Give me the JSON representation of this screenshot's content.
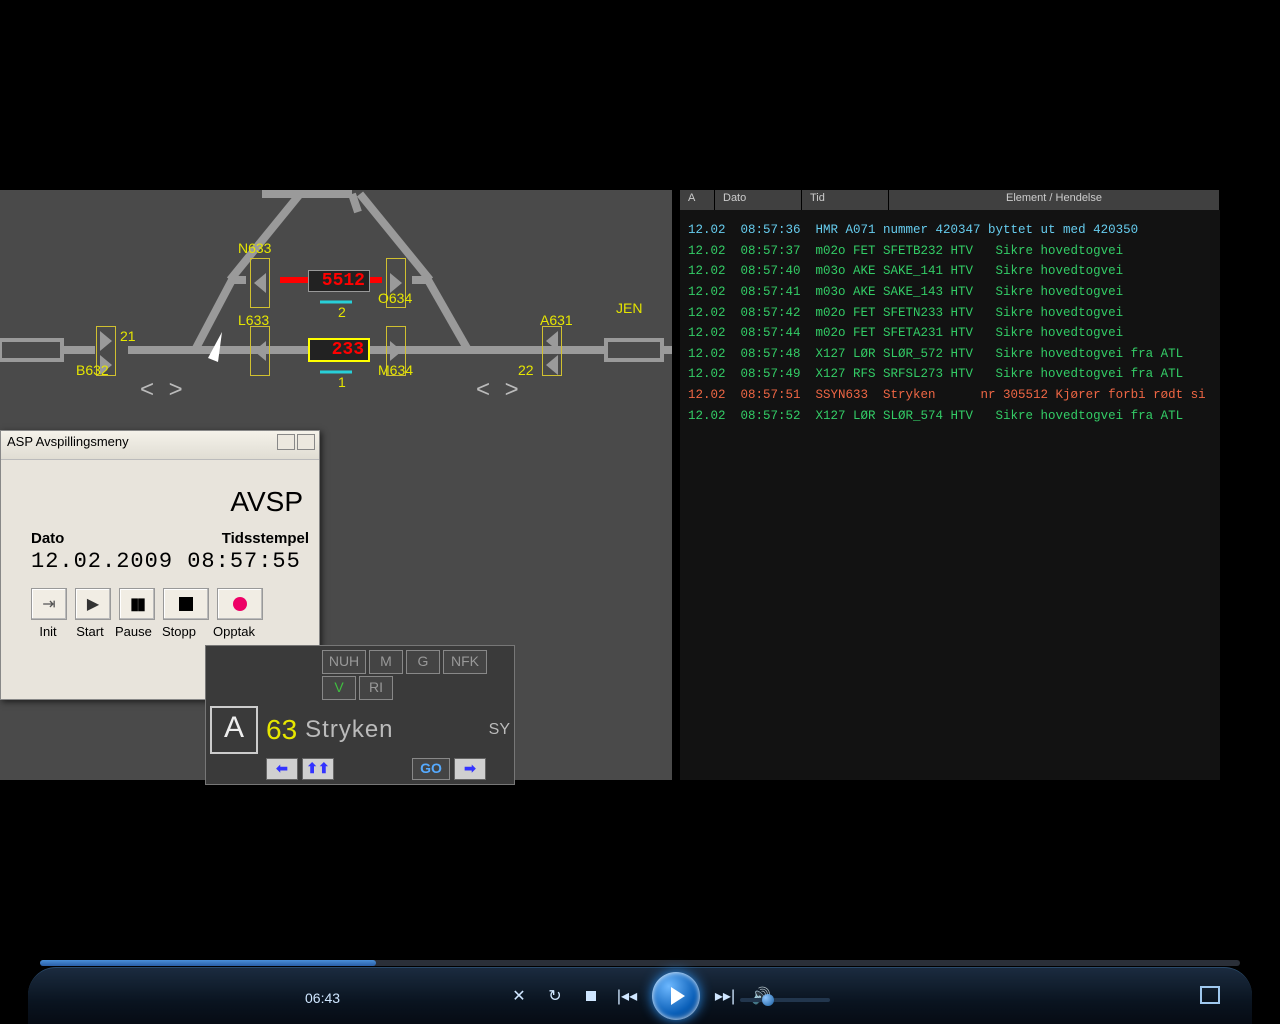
{
  "log": {
    "headers": {
      "a": "A",
      "dato": "Dato",
      "tid": "Tid",
      "ev": "Element / Hendelse"
    },
    "rows": [
      {
        "c": "cyan",
        "d": "12.02",
        "t": "08:57:36",
        "txt": "HMR A071 nummer 420347 byttet ut med 420350"
      },
      {
        "c": "green",
        "d": "12.02",
        "t": "08:57:37",
        "txt": "m02o FET SFETB232 HTV   Sikre hovedtogvei"
      },
      {
        "c": "green",
        "d": "12.02",
        "t": "08:57:40",
        "txt": "m03o AKE SAKE_141 HTV   Sikre hovedtogvei"
      },
      {
        "c": "green",
        "d": "12.02",
        "t": "08:57:41",
        "txt": "m03o AKE SAKE_143 HTV   Sikre hovedtogvei"
      },
      {
        "c": "green",
        "d": "12.02",
        "t": "08:57:42",
        "txt": "m02o FET SFETN233 HTV   Sikre hovedtogvei"
      },
      {
        "c": "green",
        "d": "12.02",
        "t": "08:57:44",
        "txt": "m02o FET SFETA231 HTV   Sikre hovedtogvei"
      },
      {
        "c": "green",
        "d": "12.02",
        "t": "08:57:48",
        "txt": "X127 LØR SLØR_572 HTV   Sikre hovedtogvei fra ATL"
      },
      {
        "c": "green",
        "d": "12.02",
        "t": "08:57:49",
        "txt": "X127 RFS SRFSL273 HTV   Sikre hovedtogvei fra ATL"
      },
      {
        "c": "red",
        "d": "12.02",
        "t": "08:57:51",
        "txt": "SSYN633  Stryken      nr 305512 Kjører forbi rødt si"
      },
      {
        "c": "green",
        "d": "12.02",
        "t": "08:57:52",
        "txt": "X127 LØR SLØR_574 HTV   Sikre hovedtogvei fra ATL"
      }
    ]
  },
  "diagram": {
    "jen": "JEN",
    "n633": "N633",
    "o634": "O634",
    "l633": "L633",
    "m634": "M634",
    "b632": "B632",
    "a631": "A631",
    "num21": "21",
    "num22": "22",
    "track1": "1",
    "track2": "2",
    "train_5512": "5512",
    "train_233": "233"
  },
  "avsp": {
    "title": "ASP Avspillingsmeny",
    "header": "AVSP",
    "lbl_dato": "Dato",
    "lbl_ts": "Tidsstempel",
    "value": "12.02.2009 08:57:55",
    "btn_init": "Init",
    "btn_start": "Start",
    "btn_pause": "Pause",
    "btn_stopp": "Stopp",
    "btn_opptak": "Opptak"
  },
  "selector": {
    "row1": [
      "NUH",
      "M",
      "G",
      "NFK"
    ],
    "row2": [
      "V",
      "RI"
    ],
    "A": "A",
    "num": "63",
    "name": "Stryken",
    "code": "SY",
    "go": "GO"
  },
  "player": {
    "time": "06:43"
  }
}
